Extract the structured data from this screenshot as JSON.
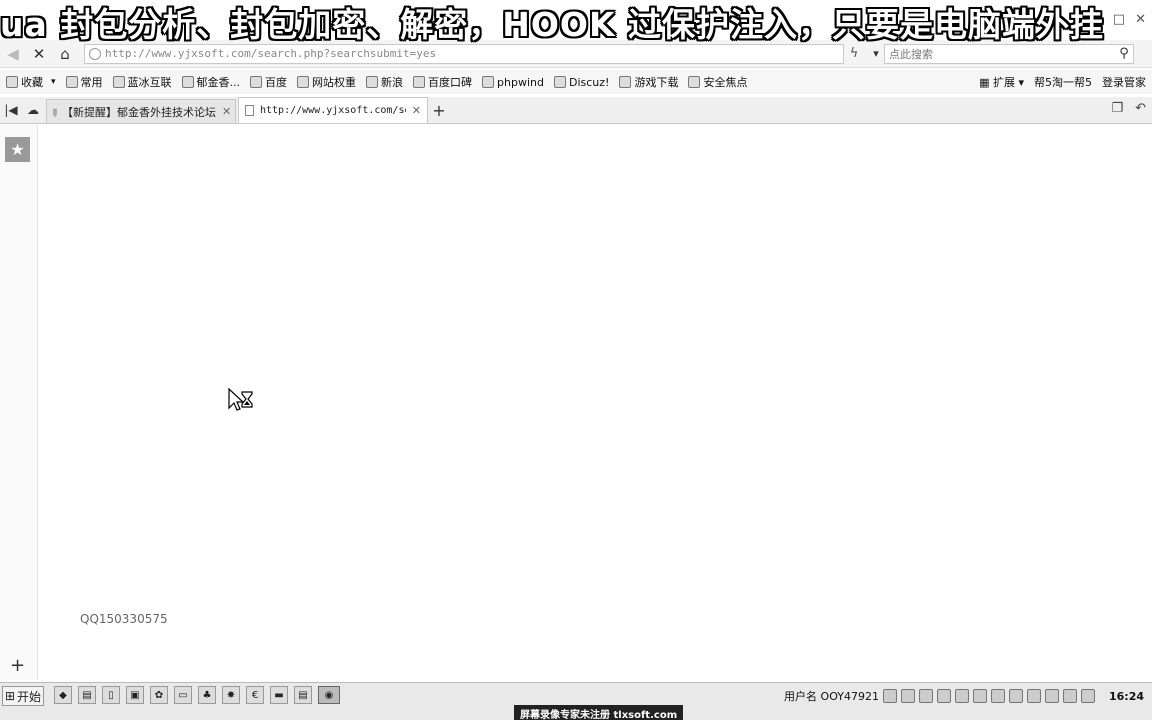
{
  "overlay": {
    "banner": "ua 封包分析、封包加密、解密，HOOK 过保护注入，只要是电脑端外挂"
  },
  "toolbar": {
    "back_icon": "back-arrow-icon",
    "stop_icon": "close-icon",
    "home_icon": "home-icon",
    "url": "http://www.yjxsoft.com/search.php?searchsubmit=yes",
    "search_placeholder": "点此搜索"
  },
  "bookmarks": {
    "items": [
      "收藏",
      "常用",
      "蓝冰互联",
      "郁金香...",
      "百度",
      "网站权重",
      "新浪",
      "百度口碑",
      "phpwind",
      "Discuz!",
      "游戏下载",
      "安全焦点"
    ],
    "right": [
      "扩展",
      "帮5淘一帮5",
      "登录管家"
    ]
  },
  "tabs": {
    "items": [
      {
        "label": "【新提醒】郁金香外挂技术论坛"
      },
      {
        "label": "http://www.yjxsoft.com/search"
      }
    ],
    "new_tab": "+"
  },
  "sidebar": {
    "favorite_icon": "star-icon",
    "add": "+"
  },
  "content": {
    "qq": "QQ150330575"
  },
  "taskbar": {
    "start_label": "开始",
    "username": "用户名 OOY47921",
    "clock": "16:24",
    "watermark": "屏幕录像专家未注册 tlxsoft.com"
  }
}
